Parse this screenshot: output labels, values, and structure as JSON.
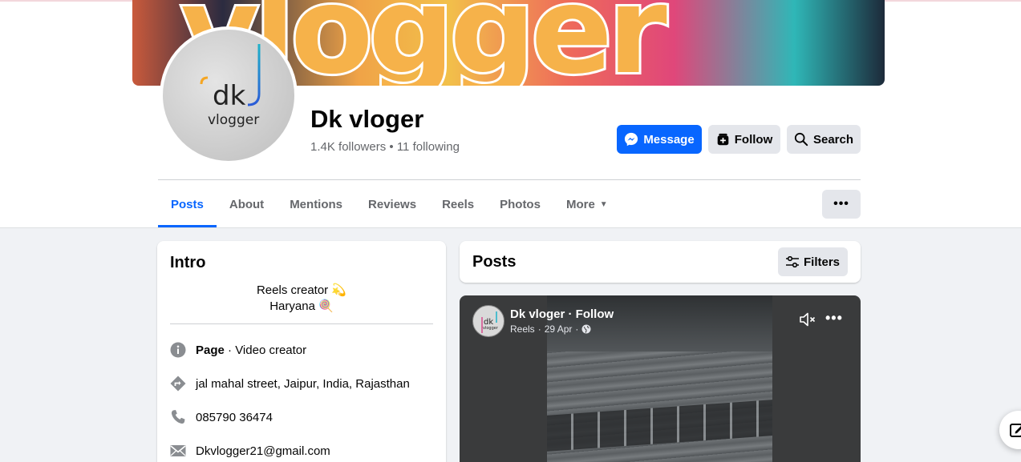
{
  "page": {
    "name": "Dk vloger",
    "followers": "1.4K followers",
    "separator": "•",
    "following": "11 following",
    "cover_text": "vlogger",
    "avatar_text": "vlogger",
    "avatar_mark": "dk"
  },
  "actions": {
    "message": "Message",
    "follow": "Follow",
    "search": "Search"
  },
  "tabs": [
    {
      "label": "Posts",
      "active": true
    },
    {
      "label": "About"
    },
    {
      "label": "Mentions"
    },
    {
      "label": "Reviews"
    },
    {
      "label": "Reels"
    },
    {
      "label": "Photos"
    },
    {
      "label": "More"
    }
  ],
  "intro": {
    "title": "Intro",
    "bio_line1": "Reels creator 💫",
    "bio_line2": "Haryana 🍭",
    "category_bold": "Page",
    "category_rest": " · Video creator",
    "address": "jal mahal street, Jaipur, India, Rajasthan",
    "phone": "085790 36474",
    "email": "Dkvlogger21@gmail.com"
  },
  "posts": {
    "title": "Posts",
    "filters": "Filters",
    "item": {
      "author": "Dk vloger · Follow",
      "type": "Reels",
      "date": "29 Apr"
    }
  },
  "colors": {
    "accent": "#0866ff",
    "button_gray": "#e4e6eb",
    "muted_text": "#65676b"
  }
}
